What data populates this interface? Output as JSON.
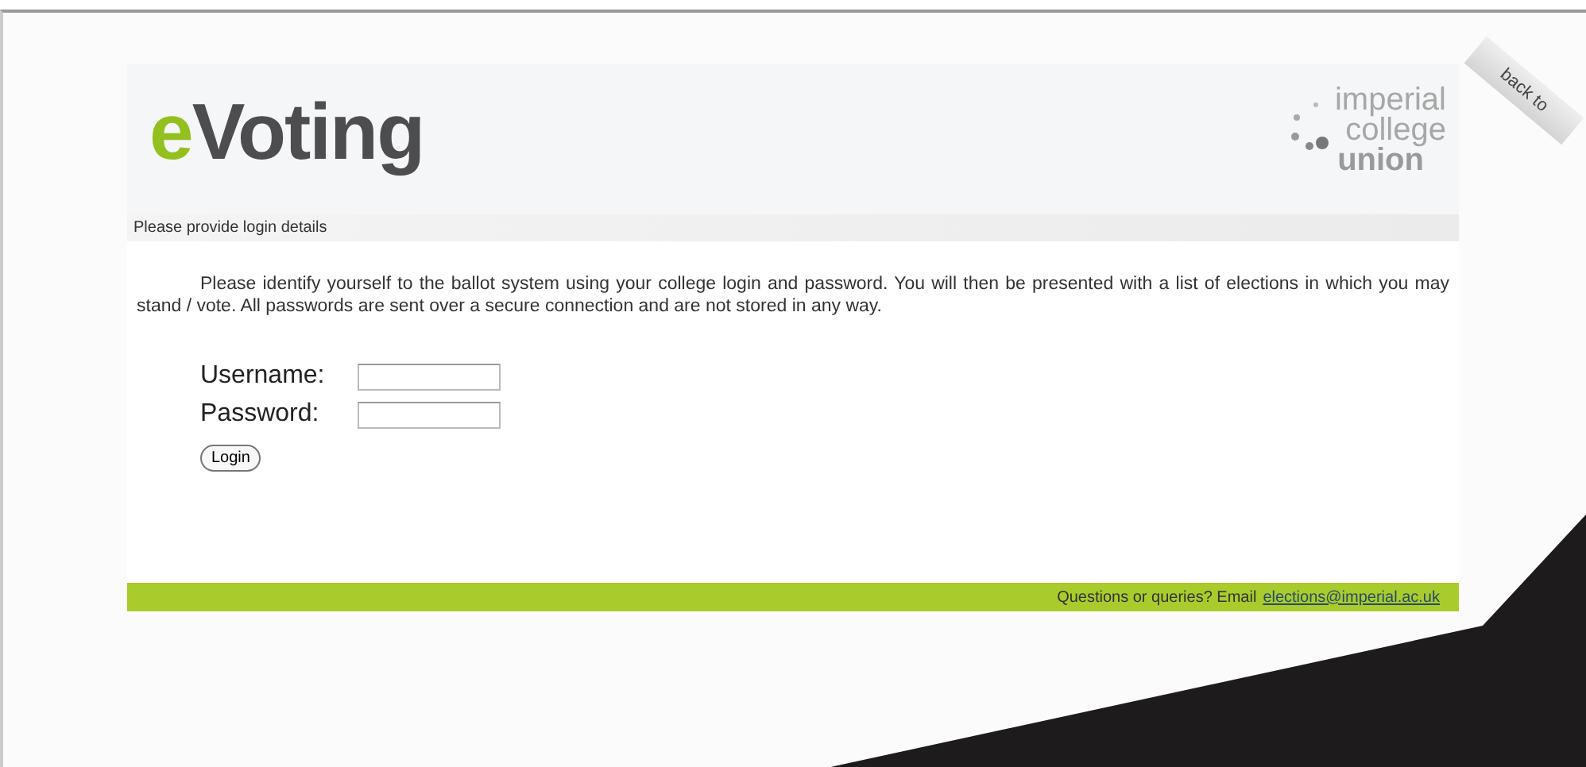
{
  "header": {
    "logo_prefix": "e",
    "logo_rest": "Voting",
    "brand": [
      "imperial",
      "college",
      "union"
    ]
  },
  "section_title": "Please provide login details",
  "intro": "Please identify yourself to the ballot system using your college login and password. You will then be presented with a list of elections in which you may stand / vote. All passwords are sent over a secure connection and are not stored in any way.",
  "fields": [
    {
      "label": "Username:"
    },
    {
      "label": "Password:"
    }
  ],
  "login_button": "Login",
  "footer": {
    "text": "Questions or queries? Email",
    "link": "elections@imperial.ac.uk"
  },
  "corner_tab": "back to"
}
